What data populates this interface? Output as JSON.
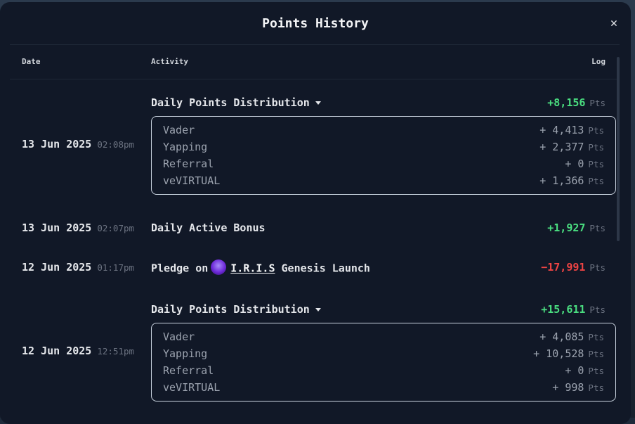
{
  "modal": {
    "title": "Points History",
    "close_icon": "✕"
  },
  "columns": {
    "date": "Date",
    "activity": "Activity",
    "log": "Log"
  },
  "unit": "Pts",
  "entries": [
    {
      "date": "13 Jun 2025",
      "time": "02:08pm",
      "activity": "Daily Points Distribution",
      "log": "+8,156",
      "sign": "positive",
      "breakdown": [
        {
          "label": "Vader",
          "value": "+ 4,413"
        },
        {
          "label": "Yapping",
          "value": "+ 2,377"
        },
        {
          "label": "Referral",
          "value": "+ 0"
        },
        {
          "label": "veVIRTUAL",
          "value": "+ 1,366"
        }
      ]
    },
    {
      "date": "13 Jun 2025",
      "time": "02:07pm",
      "activity": "Daily Active Bonus",
      "log": "+1,927",
      "sign": "positive"
    },
    {
      "date": "12 Jun 2025",
      "time": "01:17pm",
      "activity_prefix": "Pledge on",
      "activity_link": "I.R.I.S",
      "activity_suffix": "Genesis Launch",
      "icon": "iris-agent-icon",
      "log": "−17,991",
      "sign": "negative"
    },
    {
      "date": "12 Jun 2025",
      "time": "12:51pm",
      "activity": "Daily Points Distribution",
      "log": "+15,611",
      "sign": "positive",
      "breakdown": [
        {
          "label": "Vader",
          "value": "+ 4,085"
        },
        {
          "label": "Yapping",
          "value": "+ 10,528"
        },
        {
          "label": "Referral",
          "value": "+ 0"
        },
        {
          "label": "veVIRTUAL",
          "value": "+ 998"
        }
      ]
    }
  ],
  "colors": {
    "background": "#111827",
    "positive": "#4ade80",
    "negative": "#ef4444",
    "muted": "#6b7280"
  }
}
